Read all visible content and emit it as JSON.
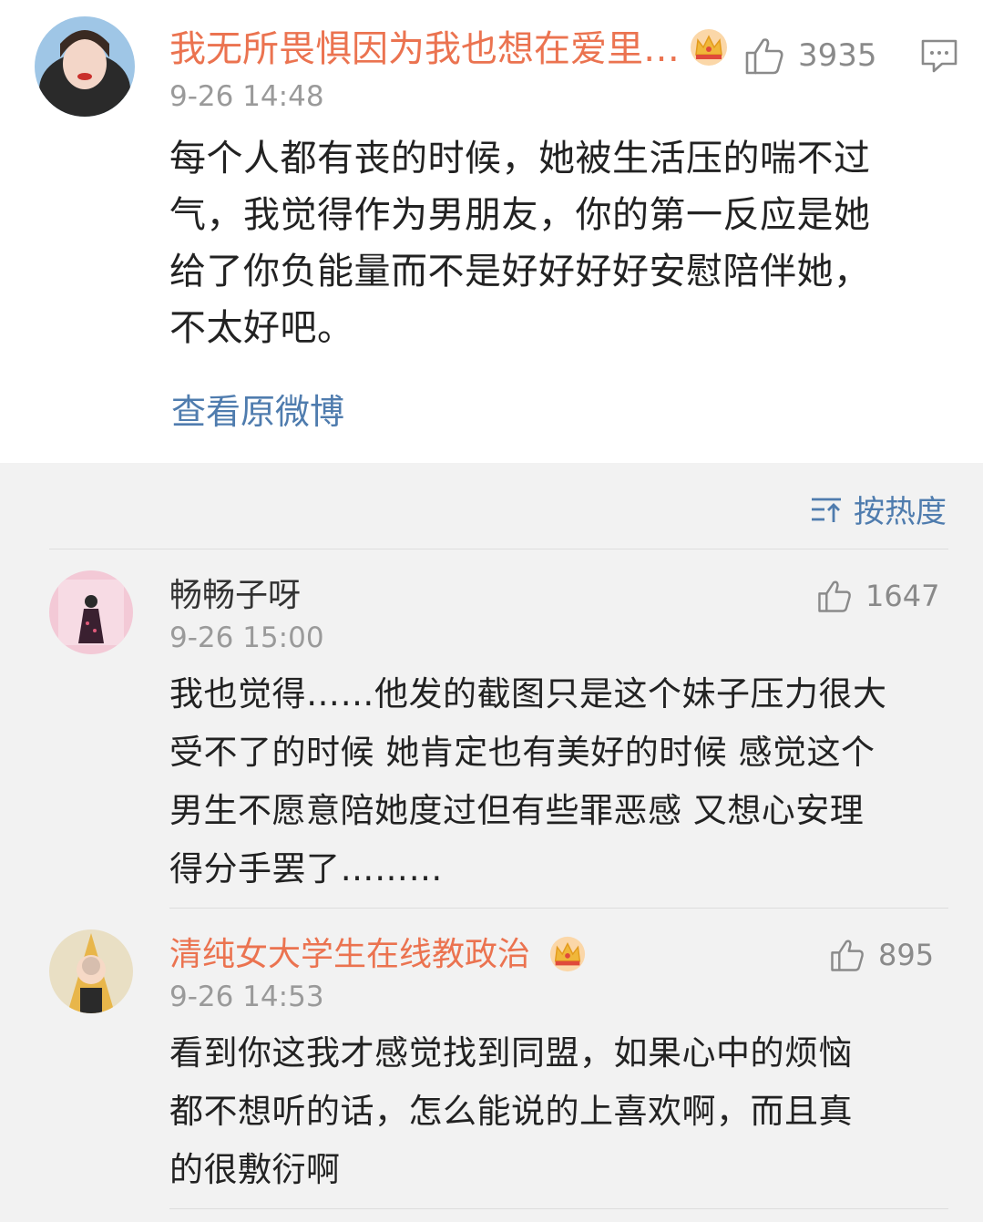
{
  "main_comment": {
    "username": "我无所畏惧因为我也想在爱里…",
    "time": "9-26 14:48",
    "likes": "3935",
    "text_lines": [
      "每个人都有丧的时候，她被生活压的喘不过",
      "气，我觉得作为男朋友，你的第一反应是她",
      "给了你负能量而不是好好好好安慰陪伴她，",
      "不太好吧。"
    ],
    "view_original": "查看原微博"
  },
  "sort": {
    "label": "按热度"
  },
  "replies": [
    {
      "username": "畅畅子呀",
      "time": "9-26 15:00",
      "likes": "1647",
      "text_lines": [
        "我也觉得……他发的截图只是这个妹子压力很大",
        "受不了的时候 她肯定也有美好的时候 感觉这个",
        "男生不愿意陪她度过但有些罪恶感 又想心安理",
        "得分手罢了………"
      ]
    },
    {
      "username": "清纯女大学生在线教政治",
      "time": "9-26 14:53",
      "likes": "895",
      "text_lines": [
        "看到你这我才感觉找到同盟，如果心中的烦恼",
        "都不想听的话，怎么能说的上喜欢啊，而且真",
        "的很敷衍啊"
      ]
    }
  ],
  "colors": {
    "username_vip": "#eb7350",
    "link_blue": "#4f7cae",
    "meta_gray": "#9a9a9a",
    "background": "#f2f2f2"
  },
  "icons": [
    "thumbs-up-icon",
    "comment-icon",
    "crown-icon",
    "sort-icon"
  ]
}
